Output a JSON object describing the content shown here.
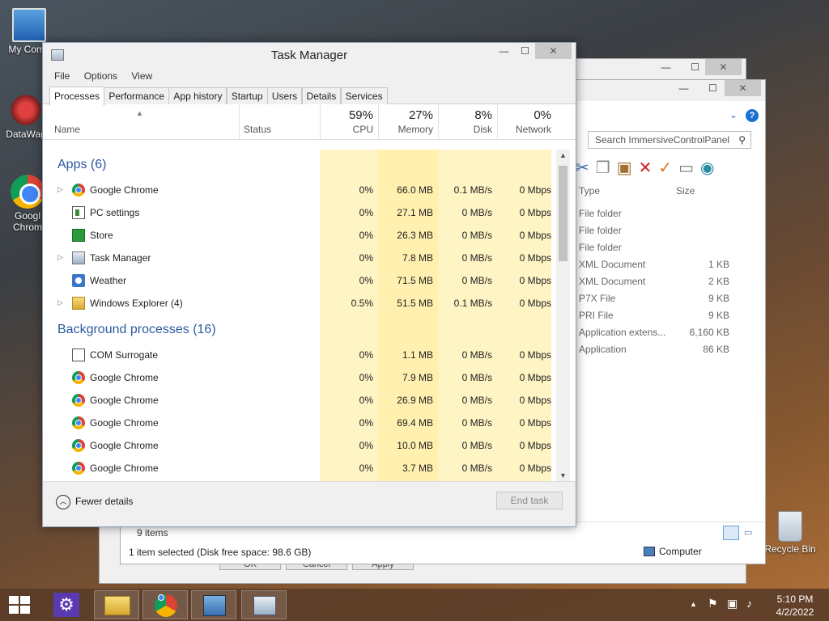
{
  "desktop": {
    "icons": [
      {
        "label": "My Comp"
      },
      {
        "label": "DataWag"
      },
      {
        "label": "Googl Chrom"
      },
      {
        "label": "Recycle Bin"
      }
    ]
  },
  "explorer": {
    "search_placeholder": "Search ImmersiveControlPanel",
    "columns": {
      "type": "Type",
      "size": "Size"
    },
    "rows": [
      {
        "type": "File folder",
        "size": ""
      },
      {
        "type": "File folder",
        "size": ""
      },
      {
        "type": "File folder",
        "size": ""
      },
      {
        "type": "XML Document",
        "size": "1 KB"
      },
      {
        "type": "XML Document",
        "size": "2 KB"
      },
      {
        "type": "P7X File",
        "size": "9 KB"
      },
      {
        "type": "PRI File",
        "size": "9 KB"
      },
      {
        "type": "Application extens...",
        "size": "6,160 KB"
      },
      {
        "type": "Application",
        "size": "86 KB"
      }
    ],
    "status_items": "9 items",
    "status_selected": "1 item selected (Disk free space: 98.6 GB)",
    "status_computer": "Computer",
    "dialog_buttons": {
      "ok": "OK",
      "cancel": "Cancel",
      "apply": "Apply"
    }
  },
  "taskmanager": {
    "title": "Task Manager",
    "menu": [
      "File",
      "Options",
      "View"
    ],
    "tabs": [
      "Processes",
      "Performance",
      "App history",
      "Startup",
      "Users",
      "Details",
      "Services"
    ],
    "active_tab": "Processes",
    "columns": {
      "name": "Name",
      "status": "Status",
      "cpu": {
        "pct": "59%",
        "label": "CPU"
      },
      "memory": {
        "pct": "27%",
        "label": "Memory"
      },
      "disk": {
        "pct": "8%",
        "label": "Disk"
      },
      "network": {
        "pct": "0%",
        "label": "Network"
      }
    },
    "groups": [
      {
        "title": "Apps (6)",
        "rows": [
          {
            "name": "Google Chrome",
            "icon": "chrome-icon",
            "expand": true,
            "cpu": "0%",
            "memory": "66.0 MB",
            "disk": "0.1 MB/s",
            "network": "0 Mbps"
          },
          {
            "name": "PC settings",
            "icon": "pc-settings-icon",
            "expand": false,
            "cpu": "0%",
            "memory": "27.1 MB",
            "disk": "0 MB/s",
            "network": "0 Mbps"
          },
          {
            "name": "Store",
            "icon": "store-icon",
            "expand": false,
            "cpu": "0%",
            "memory": "26.3 MB",
            "disk": "0 MB/s",
            "network": "0 Mbps"
          },
          {
            "name": "Task Manager",
            "icon": "task-manager-icon",
            "expand": true,
            "cpu": "0%",
            "memory": "7.8 MB",
            "disk": "0 MB/s",
            "network": "0 Mbps"
          },
          {
            "name": "Weather",
            "icon": "weather-icon",
            "expand": false,
            "cpu": "0%",
            "memory": "71.5 MB",
            "disk": "0 MB/s",
            "network": "0 Mbps"
          },
          {
            "name": "Windows Explorer (4)",
            "icon": "explorer-icon",
            "expand": true,
            "cpu": "0.5%",
            "memory": "51.5 MB",
            "disk": "0.1 MB/s",
            "network": "0 Mbps"
          }
        ]
      },
      {
        "title": "Background processes (16)",
        "rows": [
          {
            "name": "COM Surrogate",
            "icon": "com-surrogate-icon",
            "expand": false,
            "cpu": "0%",
            "memory": "1.1 MB",
            "disk": "0 MB/s",
            "network": "0 Mbps"
          },
          {
            "name": "Google Chrome",
            "icon": "chrome-icon",
            "expand": false,
            "cpu": "0%",
            "memory": "7.9 MB",
            "disk": "0 MB/s",
            "network": "0 Mbps"
          },
          {
            "name": "Google Chrome",
            "icon": "chrome-icon",
            "expand": false,
            "cpu": "0%",
            "memory": "26.9 MB",
            "disk": "0 MB/s",
            "network": "0 Mbps"
          },
          {
            "name": "Google Chrome",
            "icon": "chrome-icon",
            "expand": false,
            "cpu": "0%",
            "memory": "69.4 MB",
            "disk": "0 MB/s",
            "network": "0 Mbps"
          },
          {
            "name": "Google Chrome",
            "icon": "chrome-icon",
            "expand": false,
            "cpu": "0%",
            "memory": "10.0 MB",
            "disk": "0 MB/s",
            "network": "0 Mbps"
          },
          {
            "name": "Google Chrome",
            "icon": "chrome-icon",
            "expand": false,
            "cpu": "0%",
            "memory": "3.7 MB",
            "disk": "0 MB/s",
            "network": "0 Mbps"
          }
        ]
      }
    ],
    "fewer_details": "Fewer details",
    "end_task": "End task"
  },
  "taskbar": {
    "time": "5:10 PM",
    "date": "4/2/2022"
  }
}
